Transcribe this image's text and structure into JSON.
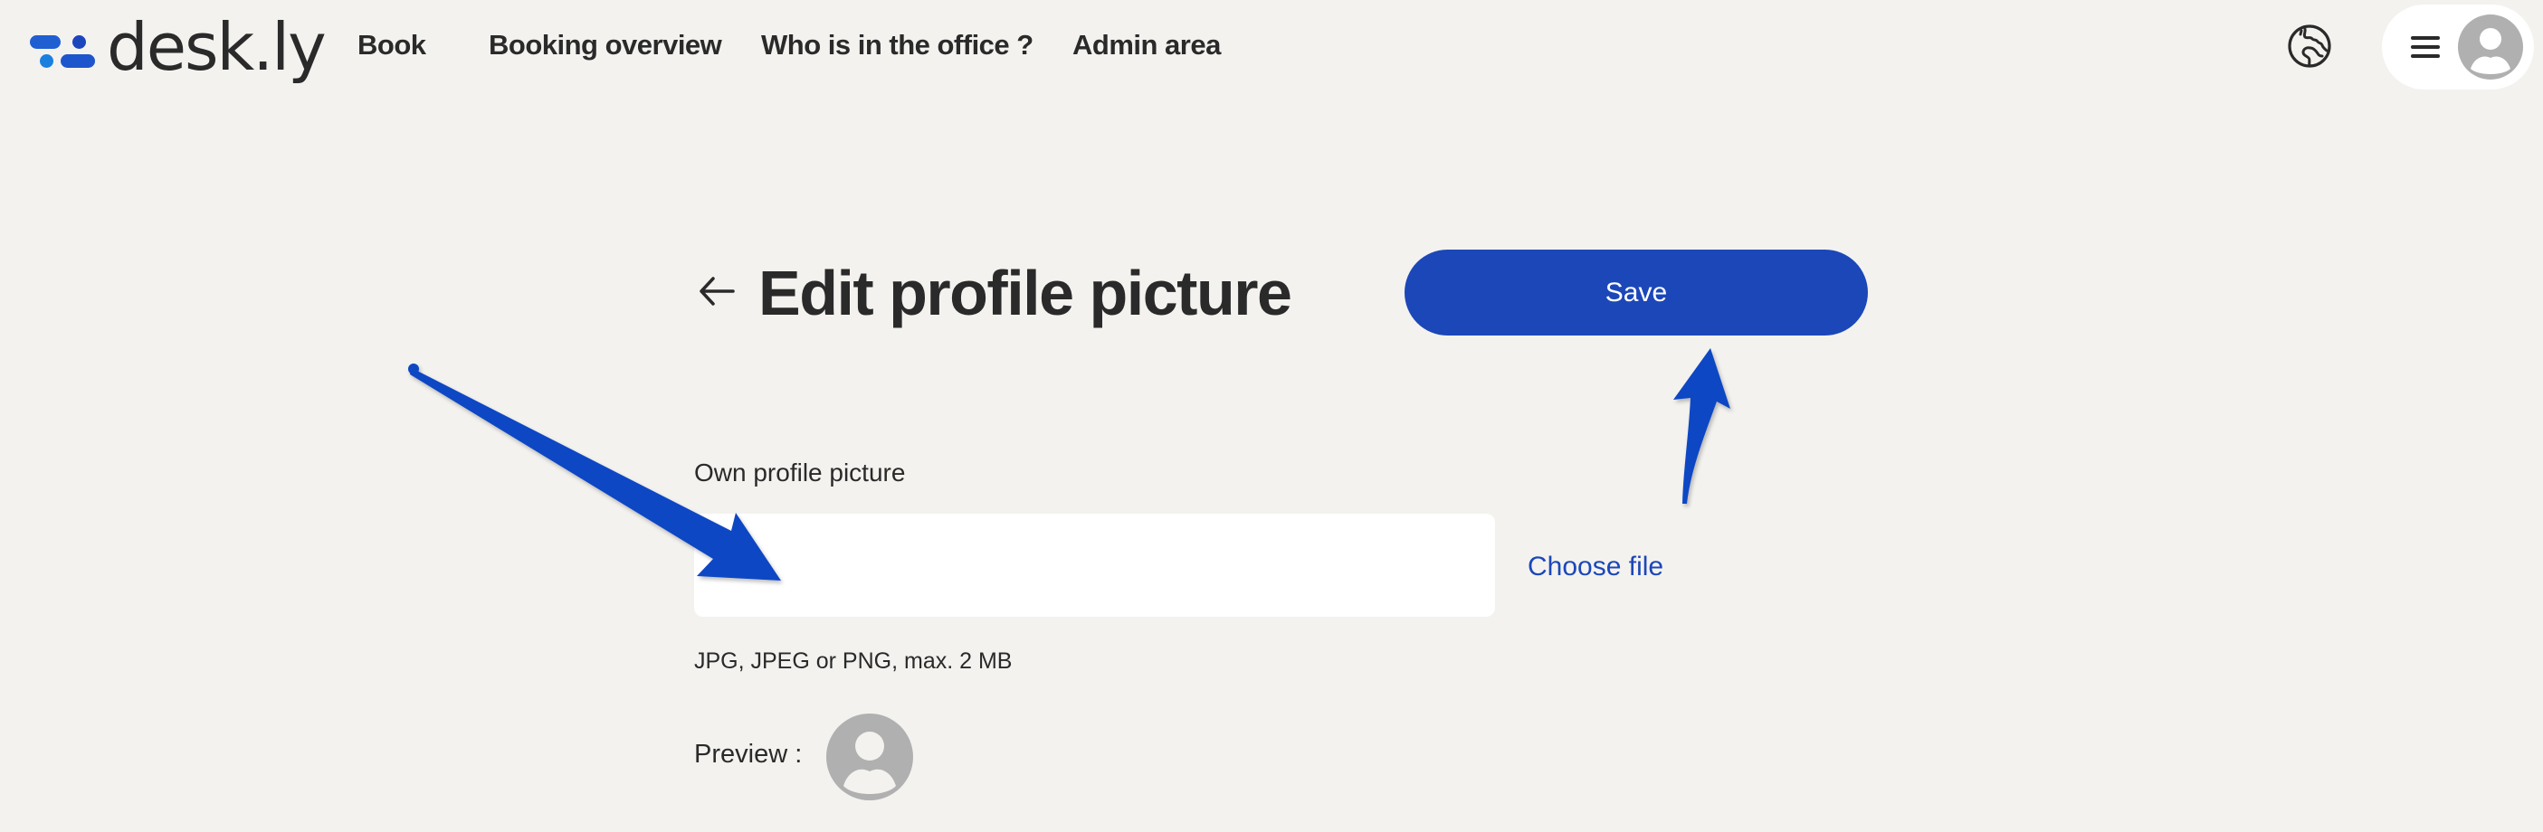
{
  "app": {
    "brand": "desk.ly",
    "colors": {
      "accent": "#1c47b8",
      "background": "#f3f2ef",
      "text": "#2a2a2a",
      "avatar_placeholder": "#b0b0b0",
      "annotation_arrow": "#0a46c4"
    }
  },
  "header": {
    "nav": [
      {
        "label": "Book"
      },
      {
        "label": "Booking overview"
      },
      {
        "label": "Who is in the office ?"
      },
      {
        "label": "Admin area"
      }
    ],
    "icons": {
      "language": "globe-icon",
      "menu": "hamburger-menu-icon",
      "user": "user-avatar-icon"
    }
  },
  "page": {
    "back_icon": "arrow-left-icon",
    "title": "Edit profile picture",
    "save_label": "Save",
    "field_label": "Own profile picture",
    "file_input_value": "",
    "choose_file_label": "Choose file",
    "hint": "JPG, JPEG or PNG, max. 2 MB",
    "preview_label": "Preview :"
  },
  "annotations": [
    {
      "type": "arrow",
      "points_to": "file-input"
    },
    {
      "type": "arrow",
      "points_to": "save-button"
    }
  ]
}
